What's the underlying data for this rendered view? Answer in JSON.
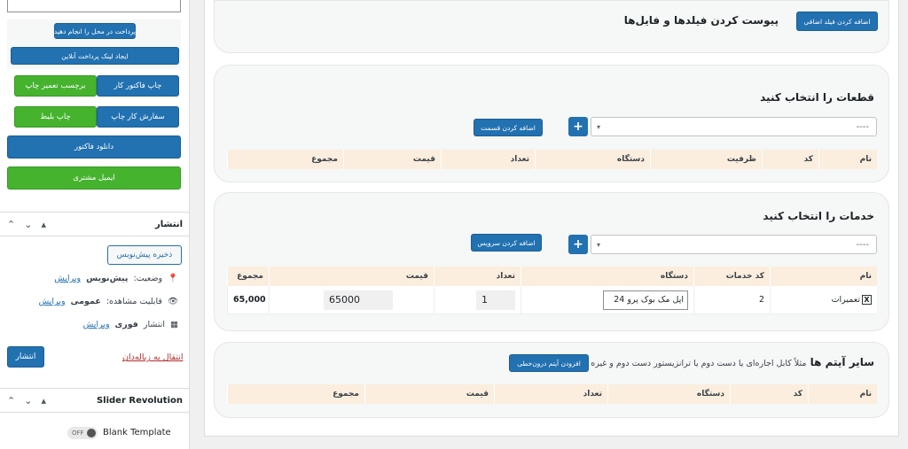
{
  "sidebar": {
    "pay_on_site": "پرداخت در محل را انجام دهید",
    "online_link": "ایجاد لینک پرداخت آنلاین",
    "print_repair_label": "برچسب تعمیر چاپ",
    "print_invoice": "چاپ فاکتور کار",
    "print_ticket": "چاپ بلیط",
    "print_job_order": "سفارش کار چاپ",
    "download_invoice": "دانلود فاکتور",
    "email_customer": "ایمیل مشتری"
  },
  "publish": {
    "title": "انتشار",
    "save_draft": "ذخیره پیش‌نویس",
    "status_label": "وضعیت:",
    "status_value": "پیش‌نویس",
    "visibility_label": "قابلیت مشاهده:",
    "visibility_value": "عمومی",
    "publish_label": "انتشار",
    "publish_value": "فوری",
    "edit": "ویرایش",
    "trash": "انتقال به زباله‌دان",
    "publish_button": "انتشار"
  },
  "slider": {
    "title": "Slider Revolution",
    "toggle": "OFF",
    "template": "Blank Template"
  },
  "attachments": {
    "title": "پیوست کردن فیلدها و فایل‌ها",
    "add_field": "اضافه کردن فیلد اضافی"
  },
  "parts": {
    "title": "قطعات را انتخاب کنید",
    "select_placeholder": "----",
    "add_button": "اضافه کردن قسمت",
    "columns": [
      "نام",
      "کد",
      "ظرفیت",
      "دستگاه",
      "تعداد",
      "قیمت",
      "مجموع"
    ]
  },
  "services": {
    "title": "خدمات را انتخاب کنید",
    "select_placeholder": "----",
    "add_button": "اضافه کردن سرویس",
    "columns": [
      "نام",
      "کد خدمات",
      "دستگاه",
      "تعداد",
      "قیمت",
      "مجموع"
    ],
    "row": {
      "x": "X",
      "name": "تعمیرات",
      "code": "2",
      "device": "اپل مک بوک پرو 24",
      "qty": "1",
      "price": "65000",
      "total": "65,000"
    }
  },
  "other": {
    "title": "سایر آیتم ها",
    "subtitle": "مثلاً کابل اجاره‌ای یا دست دوم یا ترانزیستور دست دوم و غیره",
    "add_button": "افزودن آیتم درون‌خطی",
    "columns": [
      "نام",
      "کد",
      "دستگاه",
      "تعداد",
      "قیمت",
      "مجموع"
    ]
  }
}
